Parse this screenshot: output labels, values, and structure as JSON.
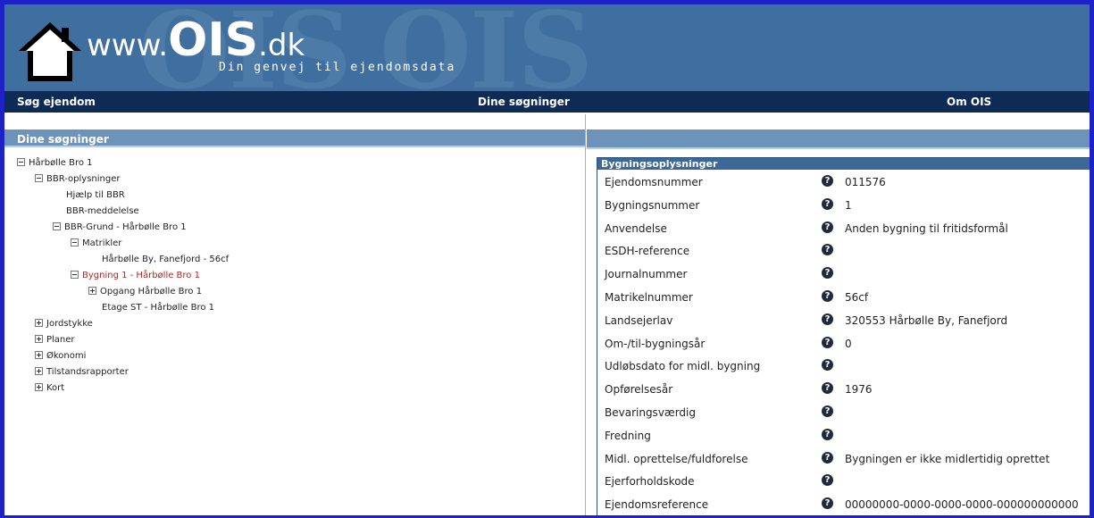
{
  "header": {
    "watermark": "OIS",
    "logo_prefix": "www.",
    "logo_main": "OIS",
    "logo_suffix": ".dk",
    "tagline": "Din genvej til ejendomsdata"
  },
  "nav": {
    "items": [
      "Søg ejendom",
      "Dine søgninger",
      "Om OIS"
    ]
  },
  "left_panel": {
    "title": "Dine søgninger"
  },
  "tree": [
    {
      "label": "Hårbølle Bro 1",
      "toggle": "minus"
    },
    {
      "label": "BBR-oplysninger",
      "toggle": "minus"
    },
    {
      "label": "Hjælp til BBR",
      "toggle": "none"
    },
    {
      "label": "BBR-meddelelse",
      "toggle": "none"
    },
    {
      "label": "BBR-Grund - Hårbølle Bro 1",
      "toggle": "minus"
    },
    {
      "label": "Matrikler",
      "toggle": "minus"
    },
    {
      "label": "Hårbølle By, Fanefjord - 56cf",
      "toggle": "none"
    },
    {
      "label": "Bygning 1 - Hårbølle Bro 1",
      "toggle": "minus",
      "selected": true
    },
    {
      "label": "Opgang Hårbølle Bro 1",
      "toggle": "plus"
    },
    {
      "label": "Etage ST - Hårbølle Bro 1",
      "toggle": "none"
    },
    {
      "label": "Jordstykke",
      "toggle": "plus"
    },
    {
      "label": "Planer",
      "toggle": "plus"
    },
    {
      "label": "Økonomi",
      "toggle": "plus"
    },
    {
      "label": "Tilstandsrapporter",
      "toggle": "plus"
    },
    {
      "label": "Kort",
      "toggle": "plus"
    }
  ],
  "info": {
    "title": "Bygningsoplysninger",
    "help_icon_glyph": "?",
    "rows": [
      {
        "label": "Ejendomsnummer",
        "value": "011576"
      },
      {
        "label": "Bygningsnummer",
        "value": "1"
      },
      {
        "label": "Anvendelse",
        "value": "Anden bygning til fritidsformål"
      },
      {
        "label": "ESDH-reference",
        "value": ""
      },
      {
        "label": "Journalnummer",
        "value": ""
      },
      {
        "label": "Matrikelnummer",
        "value": "56cf"
      },
      {
        "label": "Landsejerlav",
        "value": "320553 Hårbølle By, Fanefjord"
      },
      {
        "label": "Om-/til-bygningsår",
        "value": "0"
      },
      {
        "label": "Udløbsdato for midl. bygning",
        "value": ""
      },
      {
        "label": "Opførelsesår",
        "value": "1976"
      },
      {
        "label": "Bevaringsværdig",
        "value": ""
      },
      {
        "label": "Fredning",
        "value": ""
      },
      {
        "label": "Midl. oprettelse/fuldforelse",
        "value": "Bygningen er ikke midlertidig oprettet"
      },
      {
        "label": "Ejerforholdskode",
        "value": ""
      },
      {
        "label": "Ejendomsreference",
        "value": "00000000-0000-0000-0000-000000000000"
      }
    ]
  },
  "colors": {
    "frame": "#1d22c8",
    "header_bg": "#3f6f9e",
    "nav_bg": "#0d2b55",
    "panel_head": "#6e93bb",
    "selected_text": "#b3261e"
  }
}
